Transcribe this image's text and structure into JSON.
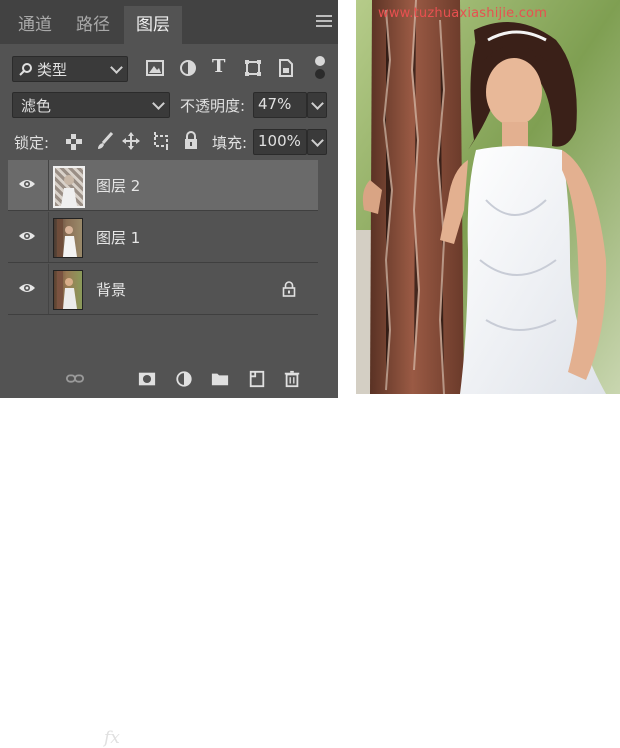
{
  "tabs": [
    {
      "label": "通道"
    },
    {
      "label": "路径"
    },
    {
      "label": "图层"
    }
  ],
  "filter": {
    "value": "类型"
  },
  "blend": {
    "mode": "滤色",
    "opacity_label": "不透明度:",
    "opacity_value": "47%"
  },
  "lock": {
    "label": "锁定:",
    "fill_label": "填充:",
    "fill_value": "100%"
  },
  "layers": [
    {
      "name": "图层 2",
      "selected": true
    },
    {
      "name": "图层 1",
      "selected": false
    },
    {
      "name": "背景",
      "selected": false,
      "locked": true
    }
  ],
  "watermark": "www.tuzhuaxiashijie.com",
  "colors": {
    "panel": "#535353",
    "tabbar": "#424242",
    "selected_layer": "#6a6a6a",
    "watermark": "#e85050"
  }
}
